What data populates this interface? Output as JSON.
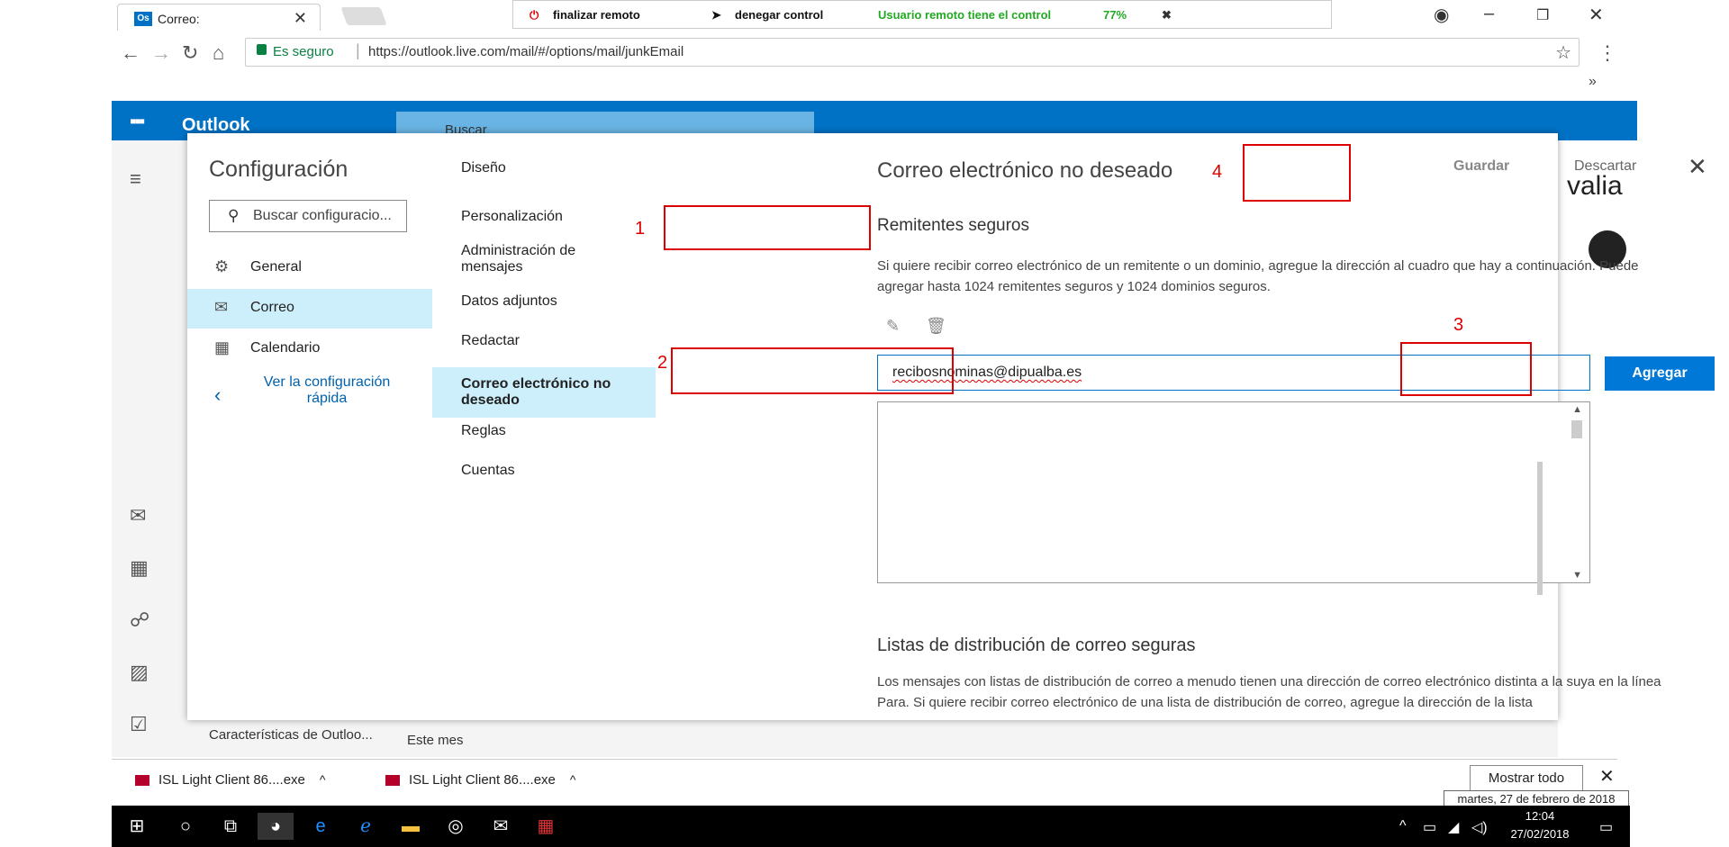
{
  "browser": {
    "tab_title": "Correo:",
    "tab_favicon": "Os",
    "remote_bar": {
      "end_label": "finalizar remoto",
      "deny_label": "denegar control",
      "status": "Usuario remoto tiene el control",
      "percent": "77%"
    },
    "secure_label": "Es seguro",
    "url": "https://outlook.live.com/mail/#/options/mail/junkEmail",
    "bookmarks_more": "»"
  },
  "outlook": {
    "brand": "Outlook",
    "search_placeholder": "Buscar",
    "footer_item": "Características de Outloo...",
    "footer_month": "Este mes",
    "ad_text": "valia"
  },
  "settings": {
    "title": "Configuración",
    "search_placeholder": "Buscar configuracio...",
    "nav": [
      {
        "label": "General",
        "icon": "gear-icon"
      },
      {
        "label": "Correo",
        "icon": "mail-icon"
      },
      {
        "label": "Calendario",
        "icon": "calendar-icon"
      }
    ],
    "quick_link": "Ver la configuración rápida",
    "subnav": [
      "Diseño",
      "Personalización",
      "Administración de mensajes",
      "Datos adjuntos",
      "Redactar",
      "Correo electrónico no deseado",
      "Reglas",
      "Cuentas"
    ],
    "page_title": "Correo electrónico no deseado",
    "save_label": "Guardar",
    "discard_label": "Descartar",
    "safe_senders_title": "Remitentes seguros",
    "safe_senders_desc": "Si quiere recibir correo electrónico de un remitente o un dominio, agregue la dirección al cuadro que hay a continuación. Puede agregar hasta 1024 remitentes seguros y 1024 dominios seguros.",
    "email_value": "recibosnominas@dipualba.es",
    "add_label": "Agregar",
    "safe_lists_title": "Listas de distribución de correo seguras",
    "safe_lists_desc": "Los mensajes con listas de distribución de correo a menudo tienen una dirección de correo electrónico distinta a la suya en la línea Para. Si quiere recibir correo electrónico de una lista de distribución de correo, agregue la dirección de la lista"
  },
  "annotations": [
    "1",
    "2",
    "3",
    "4"
  ],
  "downloads": {
    "items": [
      "ISL Light Client 86....exe",
      "ISL Light Client 86....exe"
    ],
    "show_all": "Mostrar todo",
    "date_tooltip": "martes, 27 de febrero de 2018"
  },
  "taskbar": {
    "time": "12:04",
    "date": "27/02/2018"
  },
  "colors": {
    "outlook_blue": "#0072c6",
    "button_blue": "#0078d7",
    "selected_nav": "#cdeffb",
    "annotation_red": "#dd0000",
    "remote_green": "#22aa22"
  }
}
